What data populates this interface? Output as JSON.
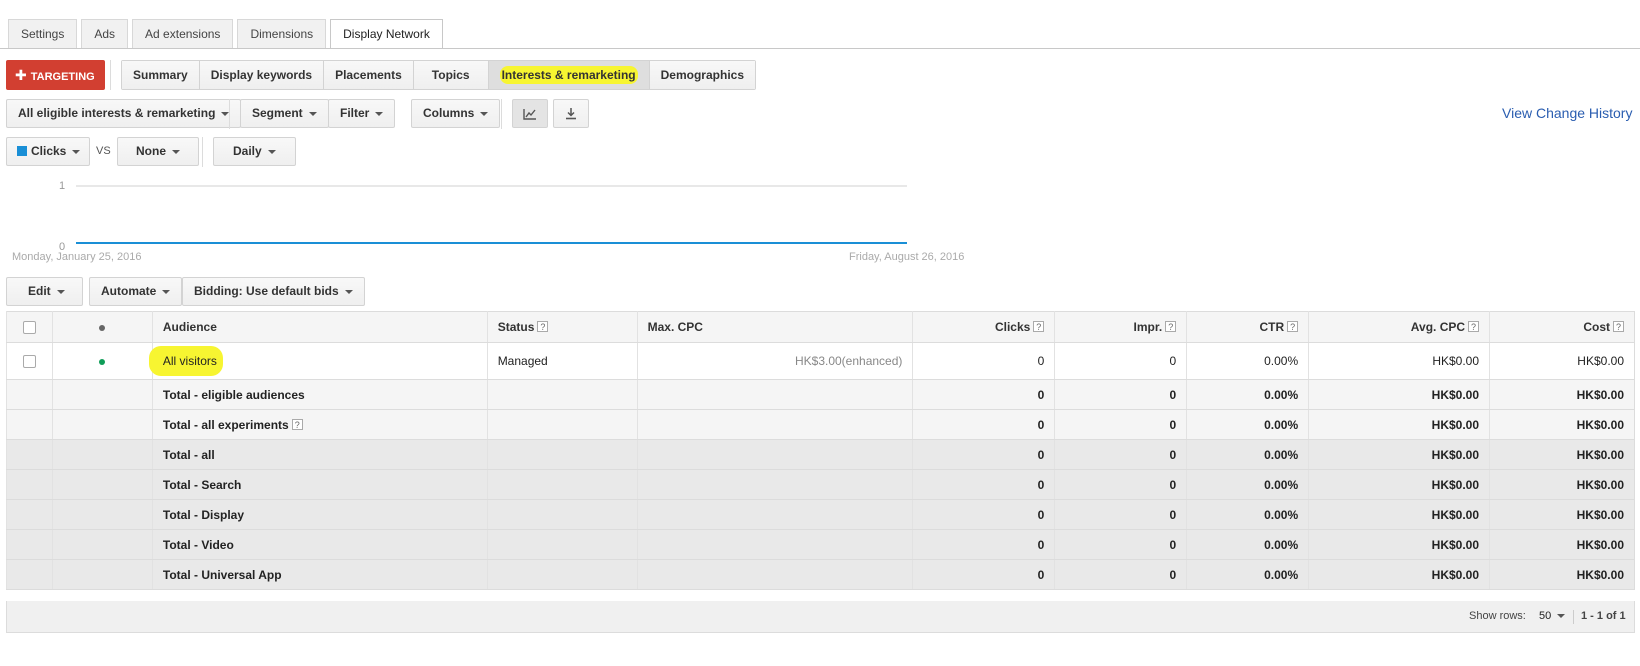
{
  "top_tabs": [
    "Settings",
    "Ads",
    "Ad extensions",
    "Dimensions",
    "Display Network"
  ],
  "targeting_button": "TARGETING",
  "sub_tabs": [
    "Summary",
    "Display keywords",
    "Placements",
    "Topics",
    "Interests & remarketing",
    "Demographics"
  ],
  "toolbar": {
    "view_filter": "All eligible interests & remarketing",
    "segment": "Segment",
    "filter": "Filter",
    "columns": "Columns",
    "chart_icon": "line-chart-icon",
    "download_icon": "download-icon",
    "view_change_history": "View Change History"
  },
  "chart_controls": {
    "metric1": "Clicks",
    "metric1_color": "#1a8fd6",
    "vs": "VS",
    "metric2": "None",
    "period": "Daily"
  },
  "chart_data": {
    "type": "line",
    "x": [
      "Monday, January 25, 2016",
      "Friday, August 26, 2016"
    ],
    "series": [
      {
        "values": [
          0,
          0
        ],
        "color": "#1a8fd6"
      }
    ],
    "ylim": [
      0,
      1
    ],
    "ytick_labels": [
      "1",
      "0"
    ],
    "xtick_labels": [
      "Monday, January 25, 2016",
      "Friday, August 26, 2016"
    ]
  },
  "actions": {
    "edit": "Edit",
    "automate": "Automate",
    "bidding": "Bidding: Use default bids"
  },
  "table": {
    "headers": {
      "audience": "Audience",
      "status": "Status",
      "max_cpc": "Max. CPC",
      "clicks": "Clicks",
      "impr": "Impr.",
      "ctr": "CTR",
      "avg_cpc": "Avg. CPC",
      "cost": "Cost"
    },
    "help_mark": "?",
    "rows": [
      {
        "audience": "All visitors",
        "status": "Managed",
        "max_cpc": "HK$3.00(enhanced)",
        "clicks": "0",
        "impr": "0",
        "ctr": "0.00%",
        "avg_cpc": "HK$0.00",
        "cost": "HK$0.00",
        "status_dot_color": "#0f9d58"
      }
    ],
    "totals": [
      {
        "label": "Total - eligible audiences",
        "clicks": "0",
        "impr": "0",
        "ctr": "0.00%",
        "avg_cpc": "HK$0.00",
        "cost": "HK$0.00"
      },
      {
        "label": "Total - all experiments",
        "help": "?",
        "clicks": "0",
        "impr": "0",
        "ctr": "0.00%",
        "avg_cpc": "HK$0.00",
        "cost": "HK$0.00"
      },
      {
        "label": "Total - all",
        "clicks": "0",
        "impr": "0",
        "ctr": "0.00%",
        "avg_cpc": "HK$0.00",
        "cost": "HK$0.00"
      },
      {
        "label": "Total - Search",
        "clicks": "0",
        "impr": "0",
        "ctr": "0.00%",
        "avg_cpc": "HK$0.00",
        "cost": "HK$0.00"
      },
      {
        "label": "Total - Display",
        "clicks": "0",
        "impr": "0",
        "ctr": "0.00%",
        "avg_cpc": "HK$0.00",
        "cost": "HK$0.00"
      },
      {
        "label": "Total - Video",
        "clicks": "0",
        "impr": "0",
        "ctr": "0.00%",
        "avg_cpc": "HK$0.00",
        "cost": "HK$0.00"
      },
      {
        "label": "Total - Universal App",
        "clicks": "0",
        "impr": "0",
        "ctr": "0.00%",
        "avg_cpc": "HK$0.00",
        "cost": "HK$0.00"
      }
    ]
  },
  "pagination": {
    "show_rows_label": "Show rows:",
    "rows_value": "50",
    "range": "1 - 1 of 1"
  }
}
